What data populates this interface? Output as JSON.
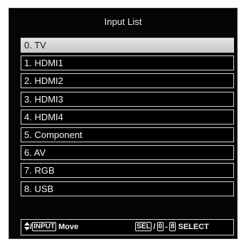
{
  "title": "Input List",
  "items": [
    {
      "label": "0. TV",
      "selected": true
    },
    {
      "label": "1. HDMI1",
      "selected": false
    },
    {
      "label": "2. HDMI2",
      "selected": false
    },
    {
      "label": "3. HDMI3",
      "selected": false
    },
    {
      "label": "4. HDMI4",
      "selected": false
    },
    {
      "label": "5. Component",
      "selected": false
    },
    {
      "label": "6. AV",
      "selected": false
    },
    {
      "label": "7. RGB",
      "selected": false
    },
    {
      "label": "8. USB",
      "selected": false
    }
  ],
  "footer": {
    "updown_icon": "up-down-arrows-icon",
    "slash": "/",
    "input_key": "INPUT",
    "move_label": "Move",
    "sel_key": "SEL",
    "zero_key": "0",
    "dash": "-",
    "eight_key": "8",
    "select_label": "SELECT"
  }
}
